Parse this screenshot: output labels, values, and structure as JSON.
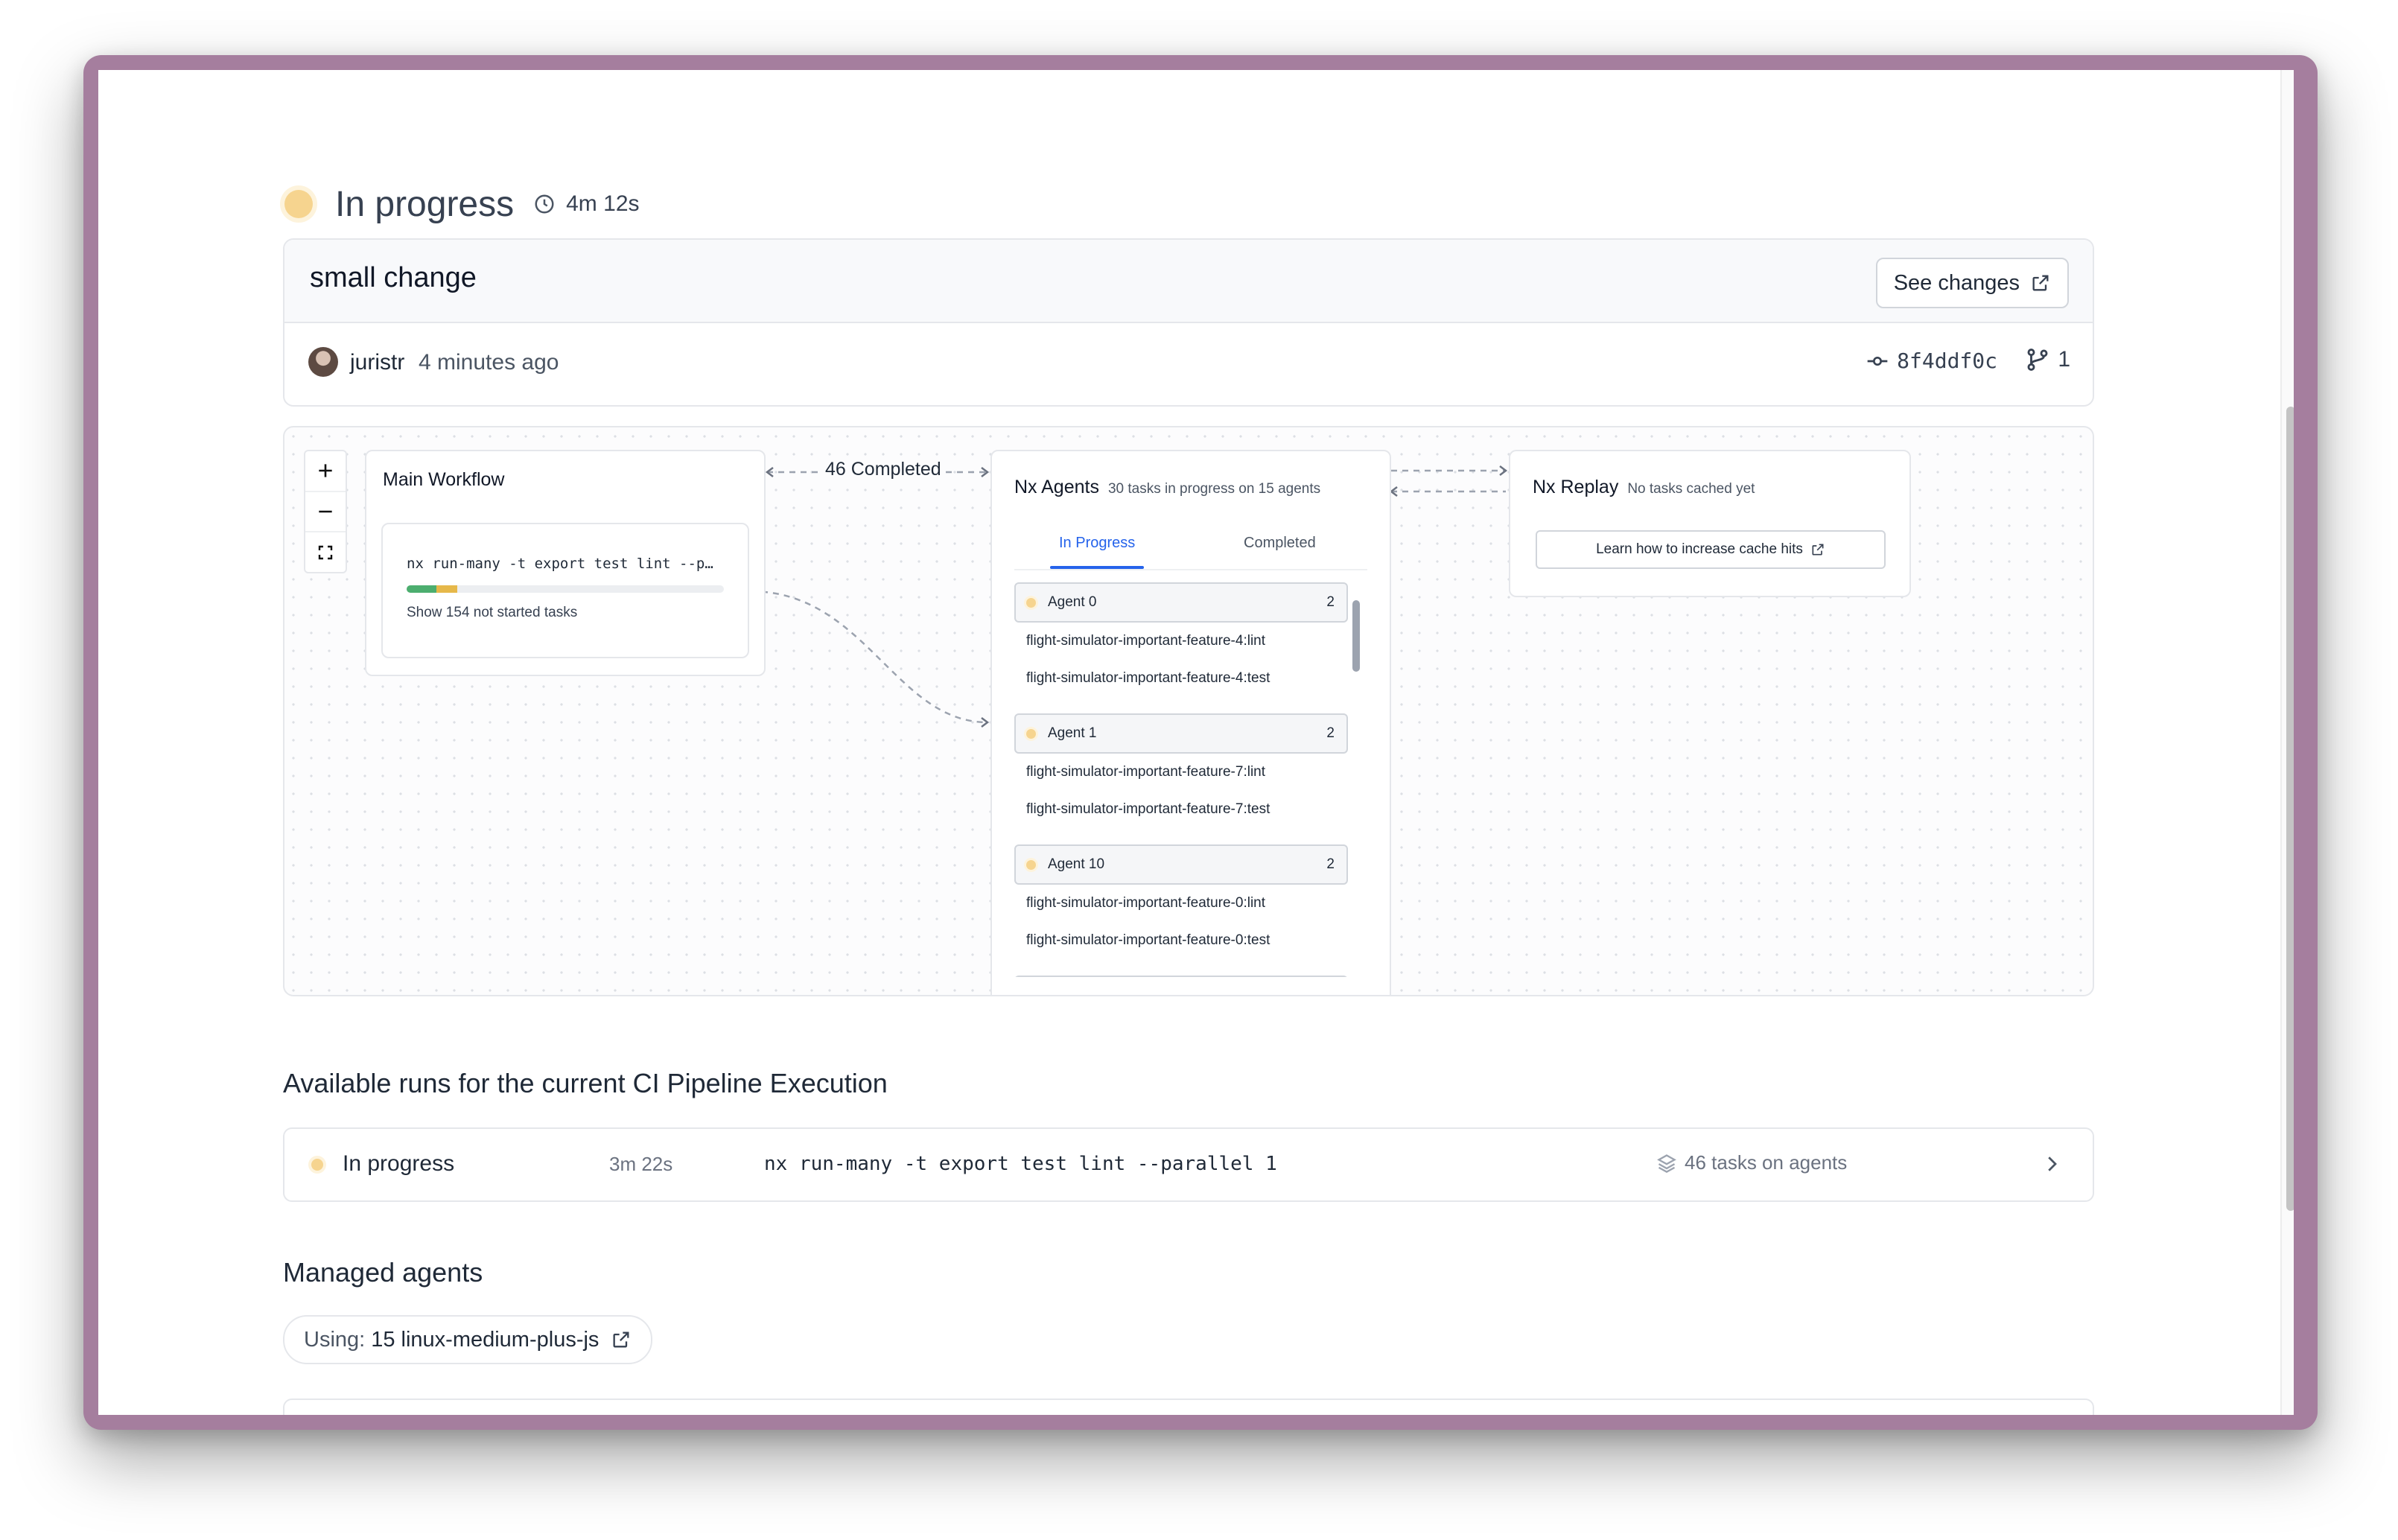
{
  "header": {
    "status": "In progress",
    "duration": "4m 12s",
    "status_color": "#f6d48f"
  },
  "commit": {
    "title": "small change",
    "see_changes_label": "See changes",
    "author": "juristr",
    "time_ago": "4 minutes ago",
    "sha": "8f4ddf0c",
    "branch_count": "1"
  },
  "graph": {
    "main_workflow": {
      "title": "Main Workflow",
      "command": "nx run-many -t export test lint --p…",
      "progress_completed_fraction": 0.095,
      "progress_in_progress_fraction": 0.065,
      "not_started_label": "Show 154 not started tasks"
    },
    "edge_label": "46 Completed",
    "nx_agents": {
      "title": "Nx Agents",
      "subtitle": "30 tasks in progress on 15 agents",
      "tabs": [
        "In Progress",
        "Completed"
      ],
      "active_tab": "In Progress",
      "agents": [
        {
          "name": "Agent 0",
          "count": "2",
          "tasks": [
            "flight-simulator-important-feature-4:lint",
            "flight-simulator-important-feature-4:test"
          ]
        },
        {
          "name": "Agent 1",
          "count": "2",
          "tasks": [
            "flight-simulator-important-feature-7:lint",
            "flight-simulator-important-feature-7:test"
          ]
        },
        {
          "name": "Agent 10",
          "count": "2",
          "tasks": [
            "flight-simulator-important-feature-0:lint",
            "flight-simulator-important-feature-0:test"
          ]
        }
      ]
    },
    "nx_replay": {
      "title": "Nx Replay",
      "subtitle": "No tasks cached yet",
      "button_label": "Learn how to increase cache hits"
    },
    "zoom_controls": [
      "+",
      "−",
      "fit"
    ]
  },
  "runs": {
    "title": "Available runs for the current CI Pipeline Execution",
    "items": [
      {
        "status": "In progress",
        "duration": "3m 22s",
        "command": "nx run-many -t export test lint --parallel 1",
        "tasks": "46 tasks on agents"
      }
    ]
  },
  "managed_agents": {
    "title": "Managed agents",
    "using_label": "Using:",
    "using_value": "15 linux-medium-plus-js"
  },
  "colors": {
    "accent_blue": "#2563eb",
    "in_progress": "#f6d48f",
    "progress_green": "#4cae6f",
    "progress_yellow": "#e6b84a",
    "frame": "#a57e9e"
  }
}
